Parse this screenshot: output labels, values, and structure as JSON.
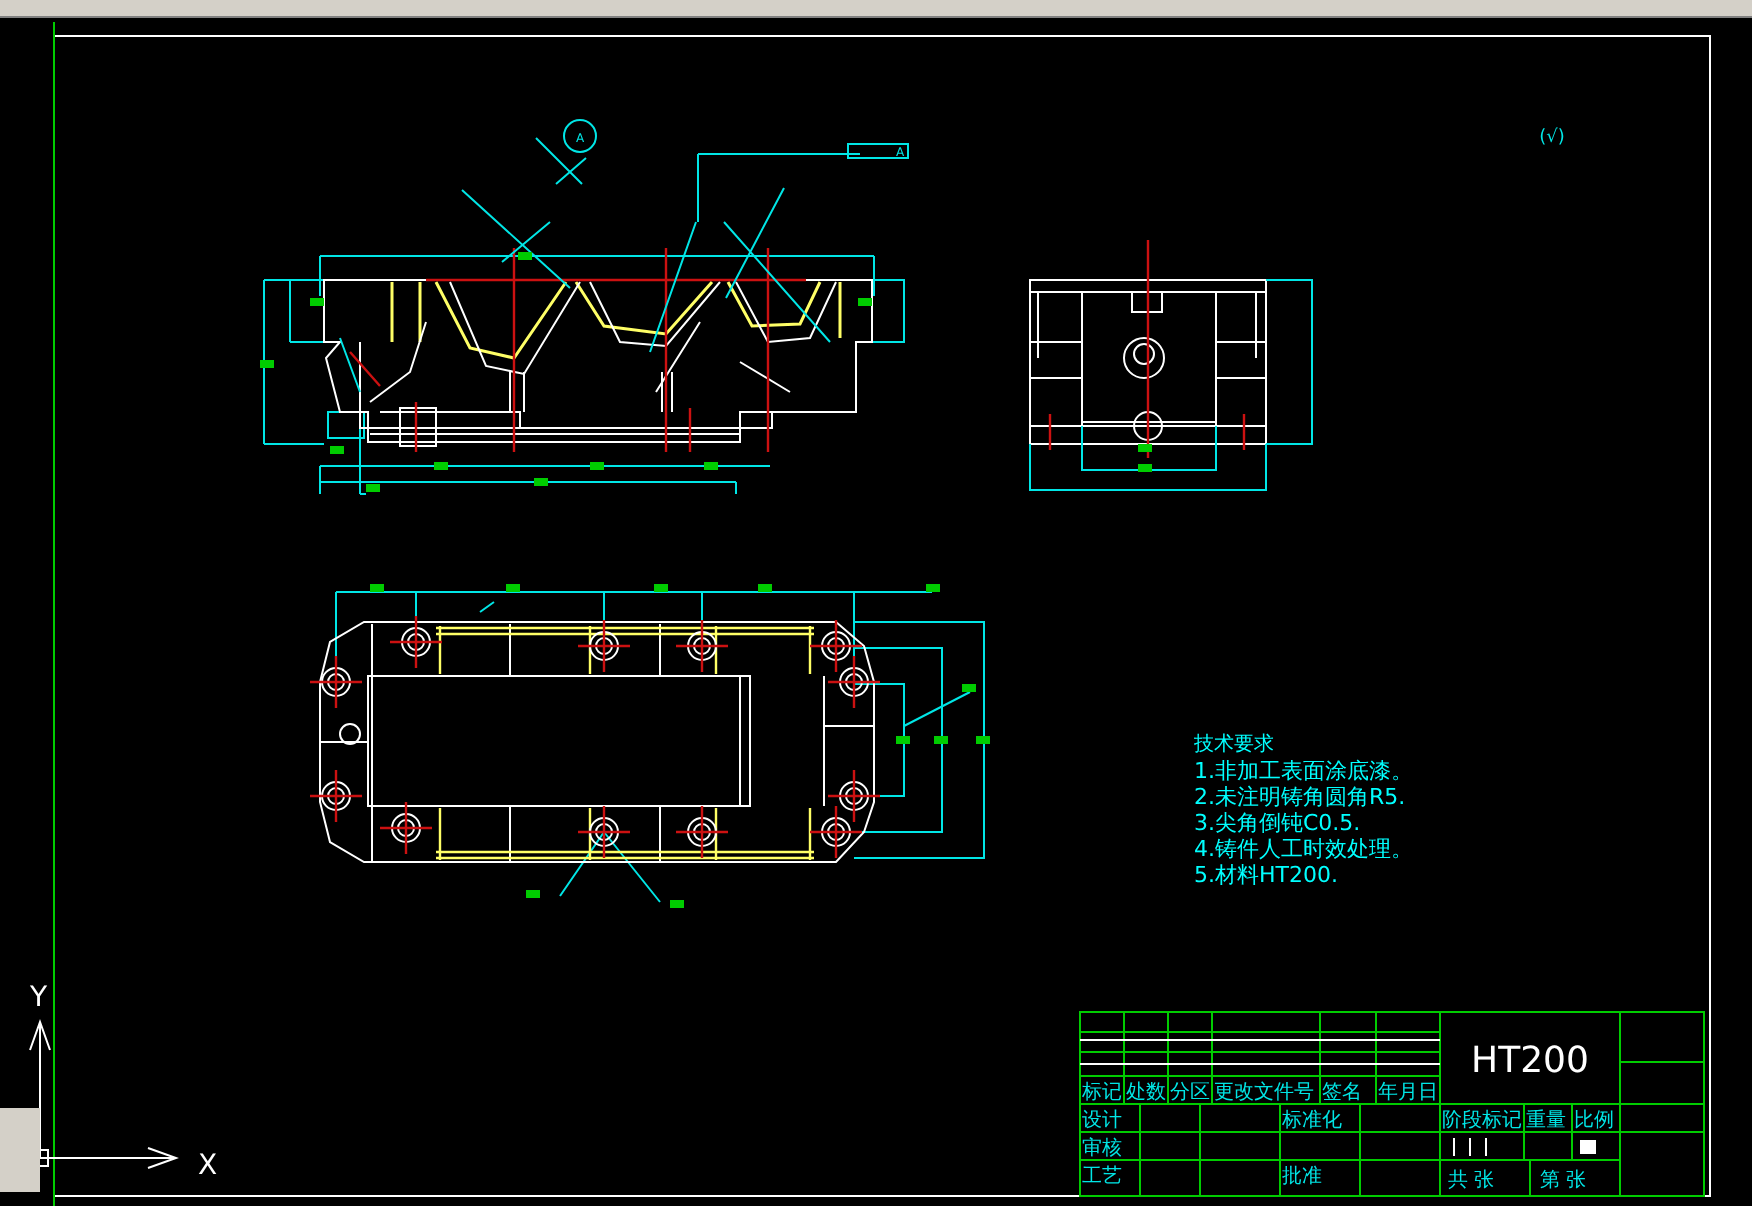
{
  "roughness_symbol": "(√)",
  "datum_label": "A",
  "tolerance_datum": "A",
  "notes": {
    "title": "技术要求",
    "lines": [
      "1.非加工表面涂底漆。",
      "2.未注明铸角圆角R5.",
      "3.尖角倒钝C0.5.",
      "4.铸件人工时效处理。",
      "5.材料HT200."
    ]
  },
  "title_block": {
    "material": "HT200",
    "change_headers": [
      "标记",
      "处数",
      "分区",
      "更改文件号",
      "签名",
      "年月日"
    ],
    "sign_rows": [
      [
        "设计",
        "标准化"
      ],
      [
        "审核"
      ],
      [
        "工艺",
        "批准"
      ]
    ],
    "stage_headers": [
      "阶段标记",
      "重量",
      "比例"
    ],
    "sheet_labels": [
      "共 张",
      "第 张"
    ]
  },
  "axes": {
    "x": "X",
    "y": "Y"
  }
}
